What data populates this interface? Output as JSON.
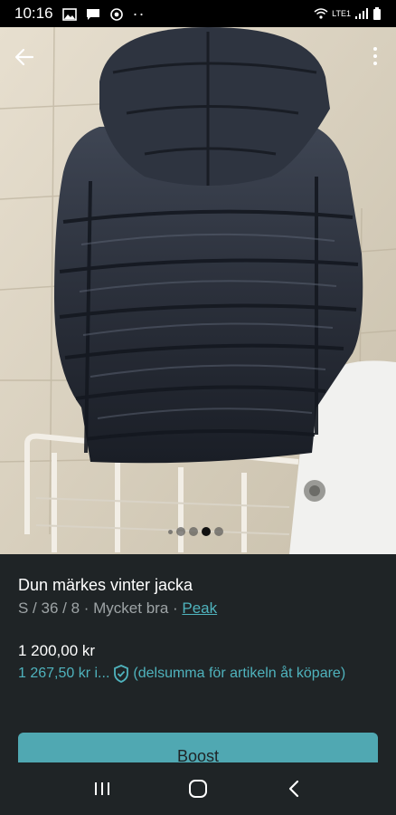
{
  "status_bar": {
    "time": "10:16",
    "dots": "··",
    "network": "LTE1",
    "icons": [
      "image-icon",
      "message-icon",
      "chrome-icon",
      "wifi-icon",
      "signal-icon",
      "battery-icon"
    ]
  },
  "gallery": {
    "image_count": 5,
    "active_index": 3
  },
  "listing": {
    "title": "Dun märkes vinter jacka",
    "details": "S / 36 / 8 · Mycket bra · ",
    "brand": "Peak",
    "price": "1 200,00 kr",
    "buyer_price": "1 267,50 kr  i...",
    "buyer_note": "(delsumma för artikeln åt köpare)"
  },
  "actions": {
    "boost_label": "Boost"
  },
  "colors": {
    "background": "#1f2426",
    "accent": "#4fb3bd",
    "boost_button": "#50a8b2"
  }
}
